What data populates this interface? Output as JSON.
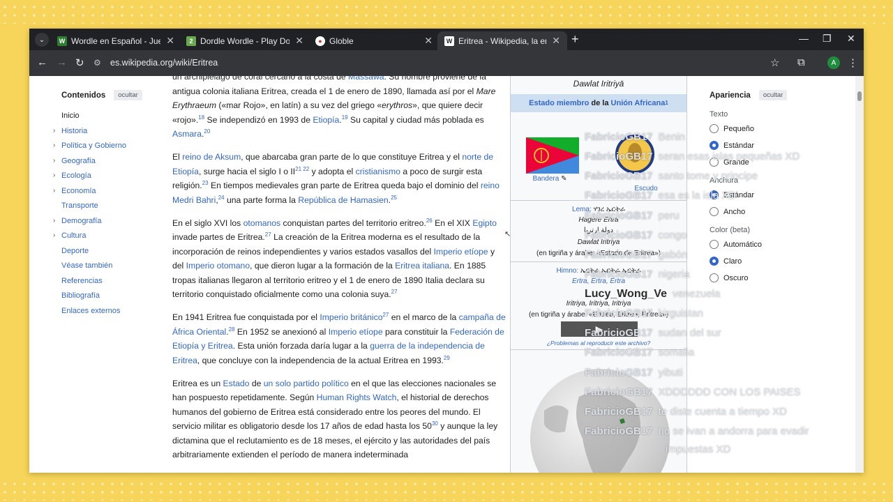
{
  "browser": {
    "tabs": [
      {
        "title": "Wordle en Español - Juega Wor",
        "favicon": "W",
        "color": "#2e7d32"
      },
      {
        "title": "Dordle Wordle - Play Dordle Ga",
        "favicon": "2",
        "color": "#6aa84f"
      },
      {
        "title": "Globle",
        "favicon": "●",
        "color": "#c0392b"
      },
      {
        "title": "Eritrea - Wikipedia, la enciclope",
        "favicon": "W",
        "color": "#555"
      }
    ],
    "url": "es.wikipedia.org/wiki/Eritrea",
    "profile_initial": "A"
  },
  "toc": {
    "title": "Contenidos",
    "hide_label": "ocultar",
    "items": [
      {
        "label": "Inicio",
        "expandable": false
      },
      {
        "label": "Historia",
        "expandable": true
      },
      {
        "label": "Política y Gobierno",
        "expandable": true
      },
      {
        "label": "Geografía",
        "expandable": true
      },
      {
        "label": "Ecología",
        "expandable": true
      },
      {
        "label": "Economía",
        "expandable": true
      },
      {
        "label": "Transporte",
        "expandable": false
      },
      {
        "label": "Demografía",
        "expandable": true
      },
      {
        "label": "Cultura",
        "expandable": true
      },
      {
        "label": "Deporte",
        "expandable": false
      },
      {
        "label": "Véase también",
        "expandable": false
      },
      {
        "label": "Referencias",
        "expandable": false
      },
      {
        "label": "Bibliografía",
        "expandable": false
      },
      {
        "label": "Enlaces externos",
        "expandable": false
      }
    ]
  },
  "article": {
    "p1": [
      {
        "t": "un archipiélago de coral cercano a la costa de "
      },
      {
        "l": "Massawa"
      },
      {
        "t": ". Su nombre proviene de la antigua colonia italiana Eritrea, creada el 1 de enero de 1890, llamada así por el "
      },
      {
        "i": "Mare Erythraeum"
      },
      {
        "t": " («mar Rojo», en latín) a su vez del griego «"
      },
      {
        "i": "erythros"
      },
      {
        "t": "», que quiere decir «rojo»."
      },
      {
        "s": "18"
      },
      {
        "t": " Se independizó en 1993 de "
      },
      {
        "l": "Etiopía"
      },
      {
        "t": "."
      },
      {
        "s": "19"
      },
      {
        "t": " Su capital y ciudad más poblada es "
      },
      {
        "l": "Asmara"
      },
      {
        "t": "."
      },
      {
        "s": "20"
      }
    ],
    "p2": [
      {
        "t": "El "
      },
      {
        "l": "reino de Aksum"
      },
      {
        "t": ", que abarcaba gran parte de lo que constituye Eritrea y el "
      },
      {
        "l": "norte de Etiopía"
      },
      {
        "t": ", surge hacia el siglo I o II"
      },
      {
        "s": "21 22"
      },
      {
        "t": " y adopta el "
      },
      {
        "l": "cristianismo"
      },
      {
        "t": " a poco de surgir esta religión."
      },
      {
        "s": "23"
      },
      {
        "t": " En tiempos medievales gran parte de Eritrea queda bajo el dominio del "
      },
      {
        "l": "reino Medri Bahri"
      },
      {
        "t": ","
      },
      {
        "s": "24"
      },
      {
        "t": " una parte forma la "
      },
      {
        "l": "República de Hamasien"
      },
      {
        "t": "."
      },
      {
        "s": "25"
      }
    ],
    "p3": [
      {
        "t": "En el siglo XVI los "
      },
      {
        "l": "otomanos"
      },
      {
        "t": " conquistan partes del territorio eritreo."
      },
      {
        "s": "26"
      },
      {
        "t": " En el XIX "
      },
      {
        "l": "Egipto"
      },
      {
        "t": " invade partes de Eritrea."
      },
      {
        "s": "27"
      },
      {
        "t": " La creación de la Eritrea moderna es el resultado de la incorporación de reinos independientes y varios estados vasallos del "
      },
      {
        "l": "Imperio etíope"
      },
      {
        "t": " y del "
      },
      {
        "l": "Imperio otomano"
      },
      {
        "t": ", que dieron lugar a la formación de la "
      },
      {
        "l": "Eritrea italiana"
      },
      {
        "t": ". En 1885 tropas italianas llegaron al territorio eritreo y el 1 de enero de 1890 Italia declara su territorio conquistado oficialmente como una colonia suya."
      },
      {
        "s": "27"
      }
    ],
    "p4": [
      {
        "t": "En 1941 Eritrea fue conquistada por el "
      },
      {
        "l": "Imperio británico"
      },
      {
        "s": "27"
      },
      {
        "t": " en el marco de la "
      },
      {
        "l": "campaña de África Oriental"
      },
      {
        "t": "."
      },
      {
        "s": "28"
      },
      {
        "t": " En 1952 se anexionó al "
      },
      {
        "l": "Imperio etíope"
      },
      {
        "t": " para constituir la "
      },
      {
        "l": "Federación de Etiopía y Eritrea"
      },
      {
        "t": ". Esta unión forzada daría lugar a la "
      },
      {
        "l": "guerra de la independencia de Eritrea"
      },
      {
        "t": ", que concluye con la independencia de la actual Eritrea en 1993."
      },
      {
        "s": "29"
      }
    ],
    "p5": [
      {
        "t": "Eritrea es un "
      },
      {
        "l": "Estado"
      },
      {
        "t": " de "
      },
      {
        "l": "un solo partido político"
      },
      {
        "t": " en el que las elecciones nacionales se han pospuesto repetidamente. Según "
      },
      {
        "l": "Human Rights Watch"
      },
      {
        "t": ", el historial de derechos humanos del gobierno de Eritrea está considerado entre los peores del mundo. El servicio militar es obligatorio desde los 17 años de edad hasta los 50"
      },
      {
        "s": "30"
      },
      {
        "t": " y aunque la ley dictamina que el reclutamiento es de 18 meses, el ejército y las autoridades del país arbitrariamente extienden el período de manera indeterminada"
      }
    ]
  },
  "infobox": {
    "native_name": "Dawlat Iritriyā",
    "member_prefix": "Estado miembro",
    "member_mid": " de la ",
    "member_link": "Unión Africana",
    "member_sup": "1",
    "flag_label": "Bandera",
    "coat_label": "Escudo",
    "motto_label": "Lema:",
    "motto_tig": "ሃገረ ኤርትራ",
    "motto_line2": "Hagere Ertra",
    "motto_ar": "دولة إرتريا",
    "motto_line4": "Dawlat Iritriya",
    "motto_line5": "(en tigriña y árabe: «Estado de Eritrea»)",
    "anthem_label": "Himno:",
    "anthem_tig": "ኤርትራ ኤርትራ ኤርትራ",
    "anthem_line2": "Ertra, Ertra, Ertra",
    "anthem_line3": "Iritriya, Iritriya, Iritriya",
    "anthem_line4": "(en tigriña y árabe: «Eritrea, Eritrea, Eritrea»)",
    "player_note": "¿Problemas al reproducir este archivo?"
  },
  "appearance": {
    "title": "Apariencia",
    "hide_label": "ocultar",
    "text_section": "Texto",
    "text_options": [
      "Pequeño",
      "Estándar",
      "Grande"
    ],
    "text_selected": 1,
    "width_section": "Anchura",
    "width_options": [
      "Estándar",
      "Ancho"
    ],
    "width_selected": 0,
    "color_section": "Color (beta)",
    "color_options": [
      "Automático",
      "Claro",
      "Oscuro"
    ],
    "color_selected": 1
  },
  "chat": [
    {
      "name": "FabricioGB17",
      "msg": "Benin"
    },
    {
      "name": "FabricioGB17",
      "msg": "seran esas islas pequeñas XD"
    },
    {
      "name": "FabricioGB17",
      "msg": "santo tome y principe"
    },
    {
      "name": "FabricioGB17",
      "msg": "esa es la isla XD"
    },
    {
      "name": "FabricioGB17",
      "msg": "peru"
    },
    {
      "name": "FabricioGB17",
      "msg": "congo"
    },
    {
      "name": "FabricioGB17",
      "msg": "gabón"
    },
    {
      "name": "FabricioGB17",
      "msg": "nigeria"
    },
    {
      "name": "Lucy_Wong_Ve",
      "msg": "venezuela"
    },
    {
      "name": "FabricioGB17",
      "msg": "kirguistan"
    },
    {
      "name": "FabricioGB17",
      "msg": "sudan del sur"
    },
    {
      "name": "FabricioGB17",
      "msg": "somalia"
    },
    {
      "name": "FabricioGB17",
      "msg": "yibuti"
    },
    {
      "name": "FabricioGB17",
      "msg": "XDDDDDD CON LOS PAISES"
    },
    {
      "name": "FabricioGB17",
      "msg": "te diste cuenta a tiempo XD"
    },
    {
      "name": "FabricioGB17",
      "msg": "no se ivan a andorra para evadir"
    },
    {
      "name": "",
      "msg": "impuestas XD"
    }
  ]
}
